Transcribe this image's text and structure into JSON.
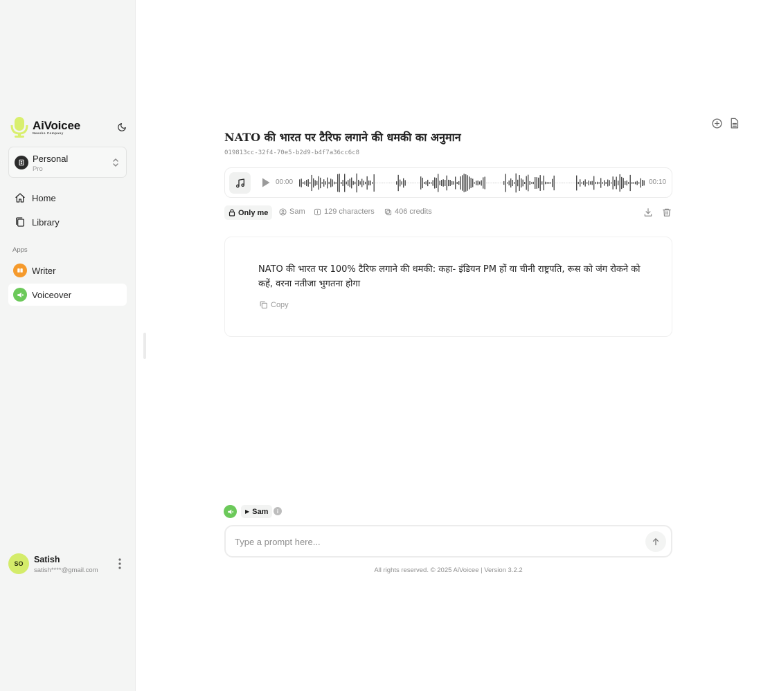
{
  "brand": {
    "name": "AiVoicee",
    "tagline": "Neesko Company"
  },
  "workspace": {
    "name": "Personal",
    "plan": "Pro"
  },
  "nav": {
    "home": "Home",
    "library": "Library"
  },
  "apps": {
    "section_label": "Apps",
    "writer": "Writer",
    "voiceover": "Voiceover"
  },
  "user": {
    "initials": "SO",
    "name": "Satish",
    "email": "satish****@gmail.com"
  },
  "document": {
    "title": "NATO की भारत पर टैरिफ लगाने की धमकी का अनुमान",
    "id": "019813cc-32f4-70e5-b2d9-b4f7a36cc6c8"
  },
  "player": {
    "current_time": "00:00",
    "duration": "00:10",
    "progress": 0
  },
  "meta": {
    "visibility": "Only me",
    "voice": "Sam",
    "characters": "129 characters",
    "credits": "406 credits"
  },
  "content": {
    "text": "NATO की भारत पर 100% टैरिफ लगाने की धमकी: कहा- इंडियन PM हों या चीनी राष्ट्रपति, रूस को जंग रोकने को कहें, वरना नतीजा भुगतना होगा",
    "copy_label": "Copy"
  },
  "prompt": {
    "voice": "Sam",
    "placeholder": "Type a prompt here...",
    "value": ""
  },
  "footer": "All rights reserved. © 2025 AiVoicee | Version 3.2.2",
  "colors": {
    "sidebar_bg": "#f4f5f4",
    "writer_badge": "#f59a2c",
    "voiceover_badge": "#6cc95a",
    "avatar_bg": "#d4ec6a",
    "logo": "#d9ef6e"
  }
}
